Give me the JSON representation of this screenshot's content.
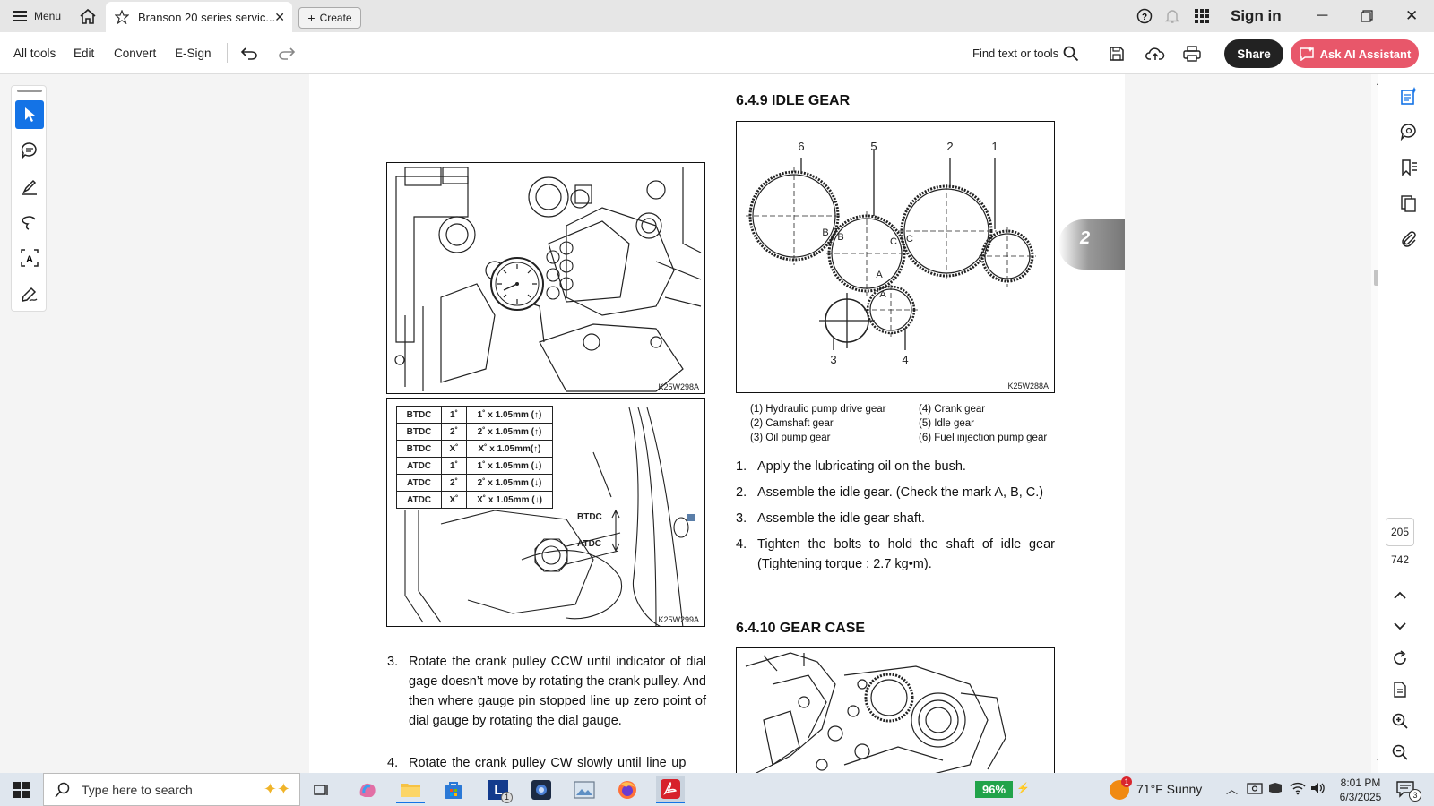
{
  "titlebar": {
    "menu_label": "Menu",
    "tab_title": "Branson 20 series servic...",
    "create_label": "Create",
    "sign_in": "Sign in"
  },
  "toolbar": {
    "all_tools": "All tools",
    "edit": "Edit",
    "convert": "Convert",
    "esign": "E-Sign",
    "find": "Find text or tools",
    "share": "Share",
    "ask_ai": "Ask AI Assistant"
  },
  "document": {
    "section_tab": "2",
    "left_fig_top_code": "K25W298A",
    "left_fig_bottom_code": "K25W299A",
    "timing_table": [
      [
        "BTDC",
        "1˚",
        "1˚ x 1.05mm (↑)"
      ],
      [
        "BTDC",
        "2˚",
        "2˚ x 1.05mm (↑)"
      ],
      [
        "BTDC",
        "X˚",
        "X˚ x 1.05mm(↑)"
      ],
      [
        "ATDC",
        "1˚",
        "1˚ x 1.05mm (↓)"
      ],
      [
        "ATDC",
        "2˚",
        "2˚ x 1.05mm (↓)"
      ],
      [
        "ATDC",
        "X˚",
        "X˚ x 1.05mm (↓)"
      ]
    ],
    "btdc_label": "BTDC",
    "atdc_label": "ATDC",
    "left_steps": [
      {
        "num": "3.",
        "text": "Rotate the crank pulley CCW until indicator of dial gage doesn’t move by rotating the crank pulley. And then where gauge pin stopped line up zero point of dial gauge by rotating the dial gauge."
      },
      {
        "num": "4.",
        "text": "Rotate the crank pulley CW slowly until line up"
      }
    ],
    "idle_heading": "6.4.9 IDLE GEAR",
    "idle_fig_code": "K25W288A",
    "gear_numbers": [
      "6",
      "5",
      "2",
      "1",
      "3",
      "4"
    ],
    "gear_marks": [
      "B",
      "B",
      "C",
      "C",
      "A",
      "A"
    ],
    "legend_left": [
      "(1) Hydraulic pump drive gear",
      "(2) Camshaft gear",
      "(3) Oil pump gear"
    ],
    "legend_right": [
      "(4) Crank gear",
      "(5) Idle gear",
      "(6) Fuel injection pump gear"
    ],
    "idle_steps": [
      {
        "num": "1.",
        "text": "Apply the lubricating oil on the bush."
      },
      {
        "num": "2.",
        "text": "Assemble the idle gear. (Check the mark A, B, C.)"
      },
      {
        "num": "3.",
        "text": "Assemble the idle gear shaft."
      },
      {
        "num": "4.",
        "text": "Tighten the bolts to hold the shaft of idle gear (Tightening torque : 2.7 kg•m)."
      }
    ],
    "gearcase_heading": "6.4.10 GEAR CASE"
  },
  "pagination": {
    "current_page": "205",
    "total_pages": "742"
  },
  "taskbar": {
    "search_placeholder": "Type here to search",
    "battery": "96%",
    "weather": "71°F  Sunny",
    "time": "8:01 PM",
    "date": "6/3/2025",
    "notification_count": "3",
    "weather_badge": "1",
    "l_badge": "1"
  },
  "colors": {
    "accent_blue": "#1473e6",
    "ai_button": "#e8576a",
    "share_button": "#222222"
  }
}
